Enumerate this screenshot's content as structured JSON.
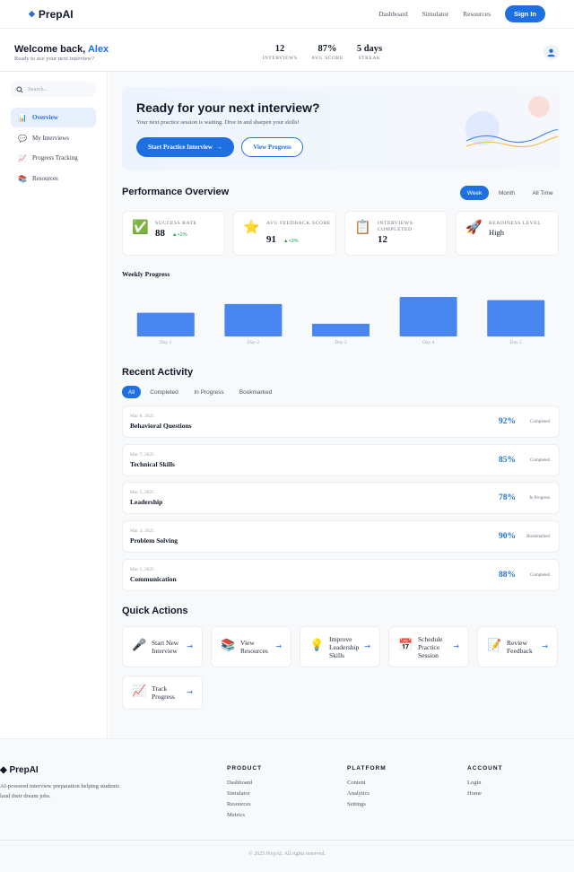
{
  "nav": {
    "brand": "PrepAI",
    "links": [
      "Dashboard",
      "Simulator",
      "Resources"
    ],
    "signin": "Sign In"
  },
  "welcome": {
    "greeting": "Welcome back,",
    "name": "Alex",
    "subtitle": "Ready to ace your next interview?",
    "stats": [
      {
        "value": "12",
        "label": "INTERVIEWS"
      },
      {
        "value": "87%",
        "label": "AVG SCORE"
      },
      {
        "value": "5 days",
        "label": "STREAK"
      }
    ]
  },
  "sidebar": {
    "search_placeholder": "Search...",
    "items": [
      {
        "label": "Overview",
        "icon": "chart-icon",
        "glyph": "📊",
        "active": true
      },
      {
        "label": "My Interviews",
        "icon": "speech-bubble-icon",
        "glyph": "💬",
        "active": false
      },
      {
        "label": "Progress Tracking",
        "icon": "trend-up-icon",
        "glyph": "📈",
        "active": false
      },
      {
        "label": "Resources",
        "icon": "books-icon",
        "glyph": "📚",
        "active": false
      }
    ]
  },
  "hero": {
    "title": "Ready for your next interview?",
    "text": "Your next practice session is waiting. Dive in and sharpen your skills!",
    "primary": "Start Practice Interview",
    "primary_arrow": "→",
    "secondary": "View Progress"
  },
  "performance": {
    "title": "Performance Overview",
    "periods": [
      "Week",
      "Month",
      "All Time"
    ],
    "active_period": "Week",
    "cards": [
      {
        "label": "SUCCESS RATE",
        "value": "88",
        "change": "+2%",
        "icon": "check-icon",
        "glyph": "✅"
      },
      {
        "label": "AVG FEEDBACK SCORE",
        "value": "91",
        "change": "+3%",
        "icon": "star-icon",
        "glyph": "⭐"
      },
      {
        "label": "INTERVIEWS COMPLETED",
        "value": "12",
        "change": "",
        "icon": "clipboard-icon",
        "glyph": "📋"
      },
      {
        "label": "READINESS LEVEL",
        "value": "High",
        "change": "",
        "icon": "rocket-icon",
        "glyph": "🚀"
      }
    ]
  },
  "chart_data": {
    "type": "bar",
    "title": "Weekly Progress",
    "categories": [
      "Day 1",
      "Day 2",
      "Day 3",
      "Day 4",
      "Day 5"
    ],
    "values": [
      60,
      82,
      32,
      100,
      92
    ],
    "color": "#4a86f0",
    "grid": false,
    "legend": "none"
  },
  "activity": {
    "title": "Recent Activity",
    "filters": [
      "All",
      "Completed",
      "In Progress",
      "Bookmarked"
    ],
    "active_filter": "All",
    "items": [
      {
        "date": "Mar 8, 2025",
        "title": "Behavioral Questions",
        "score": "92%",
        "status": "Completed"
      },
      {
        "date": "Mar 7, 2025",
        "title": "Technical Skills",
        "score": "85%",
        "status": "Completed"
      },
      {
        "date": "Mar 5, 2025",
        "title": "Leadership",
        "score": "78%",
        "status": "In Progress"
      },
      {
        "date": "Mar 3, 2025",
        "title": "Problem Solving",
        "score": "90%",
        "status": "Bookmarked"
      },
      {
        "date": "Mar 1, 2025",
        "title": "Communication",
        "score": "88%",
        "status": "Completed"
      }
    ]
  },
  "quick_actions": {
    "title": "Quick Actions",
    "items": [
      {
        "label": "Start New Interview",
        "icon": "microphone-icon",
        "glyph": "🎤"
      },
      {
        "label": "View Resources",
        "icon": "books-icon",
        "glyph": "📚"
      },
      {
        "label": "Improve Leadership Skills",
        "icon": "lightbulb-icon",
        "glyph": "💡"
      },
      {
        "label": "Schedule Practice Session",
        "icon": "calendar-icon",
        "glyph": "📅"
      },
      {
        "label": "Review Feedback",
        "icon": "memo-icon",
        "glyph": "📝"
      },
      {
        "label": "Track Progress",
        "icon": "trend-up-icon",
        "glyph": "📈"
      }
    ],
    "arrow": "→"
  },
  "footer": {
    "brand": "PrepAI",
    "description": "AI-powered interview preparation helping students land their dream jobs.",
    "columns": [
      {
        "heading": "PRODUCT",
        "links": [
          "Dashboard",
          "Simulator",
          "Resources",
          "Metrics"
        ]
      },
      {
        "heading": "PLATFORM",
        "links": [
          "Content",
          "Analytics",
          "Settings"
        ]
      },
      {
        "heading": "ACCOUNT",
        "links": [
          "Login",
          "Home"
        ]
      }
    ],
    "copyright": "© 2025 PrepAI. All rights reserved."
  },
  "colors": {
    "accent": "#1e6fe0",
    "bar": "#4a86f0",
    "positive": "#16a34a"
  }
}
